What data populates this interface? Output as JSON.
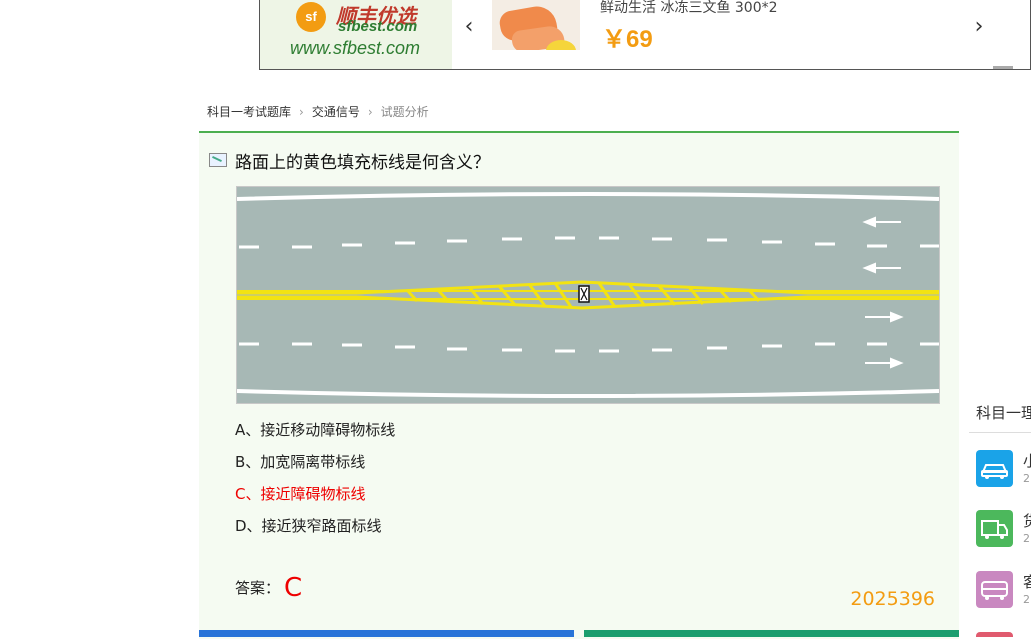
{
  "ad": {
    "brand": "顺丰优选",
    "logo_mark": "sf",
    "domain": "sfbest.com",
    "url": "www.sfbest.com",
    "product_title": "鲜动生活 冰冻三文鱼 300*2",
    "price": "￥69",
    "prev_icon": "‹",
    "next_icon": "›"
  },
  "breadcrumb": {
    "items": [
      "科目一考试题库",
      "交通信号",
      "试题分析"
    ],
    "separator": "›"
  },
  "question": {
    "text": "路面上的黄色填充标线是何含义？",
    "options": [
      {
        "label": "A、接近移动障碍物标线",
        "correct": false
      },
      {
        "label": "B、加宽隔离带标线",
        "correct": false
      },
      {
        "label": "C、接近障碍物标线",
        "correct": true
      },
      {
        "label": "D、接近狭窄路面标线",
        "correct": false
      }
    ],
    "answer_label": "答案：",
    "answer_value": "C",
    "id": "2025396"
  },
  "sidebar": {
    "title": "科目一理",
    "items": [
      {
        "name": "小",
        "count": "2",
        "icon": "car-icon",
        "color": "#1aa3e8"
      },
      {
        "name": "货",
        "count": "2",
        "icon": "truck-icon",
        "color": "#4cb85c"
      },
      {
        "name": "客",
        "count": "2",
        "icon": "bus-icon",
        "color": "#c988c0"
      }
    ]
  },
  "colors": {
    "accent_green": "#4caf50",
    "price_orange": "#f39c12",
    "correct_red": "#e00000",
    "road_gray": "#a7b8b5",
    "marking_yellow": "#f2e312"
  }
}
